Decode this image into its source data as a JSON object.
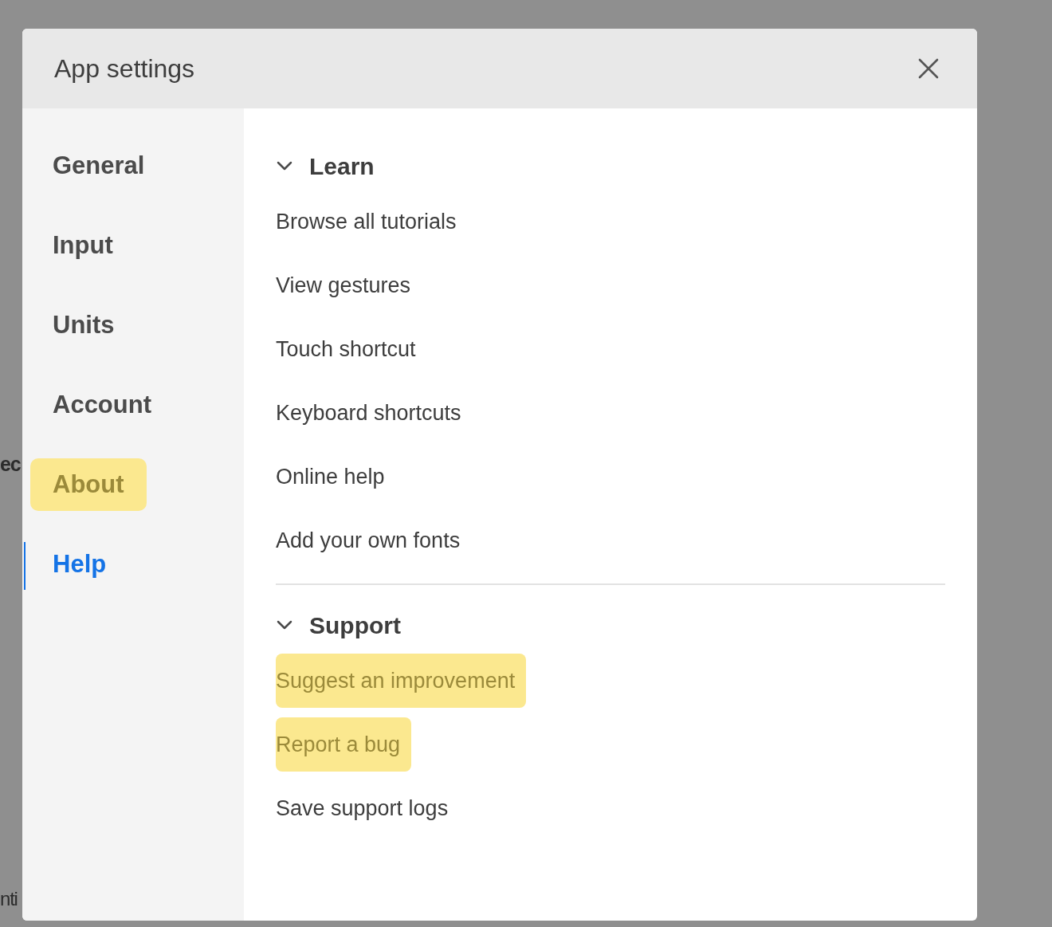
{
  "background": {
    "fragments": [
      "ec",
      "nti"
    ]
  },
  "dialog": {
    "title": "App settings",
    "sidebar": {
      "items": [
        {
          "label": "General",
          "selected": false,
          "highlighted": false
        },
        {
          "label": "Input",
          "selected": false,
          "highlighted": false
        },
        {
          "label": "Units",
          "selected": false,
          "highlighted": false
        },
        {
          "label": "Account",
          "selected": false,
          "highlighted": false
        },
        {
          "label": "About",
          "selected": false,
          "highlighted": true
        },
        {
          "label": "Help",
          "selected": true,
          "highlighted": false
        }
      ]
    },
    "sections": [
      {
        "title": "Learn",
        "expanded": true,
        "items": [
          {
            "label": "Browse all tutorials",
            "highlighted": false
          },
          {
            "label": "View gestures",
            "highlighted": false
          },
          {
            "label": "Touch shortcut",
            "highlighted": false
          },
          {
            "label": "Keyboard shortcuts",
            "highlighted": false
          },
          {
            "label": "Online help",
            "highlighted": false
          },
          {
            "label": "Add your own fonts",
            "highlighted": false
          }
        ]
      },
      {
        "title": "Support",
        "expanded": true,
        "items": [
          {
            "label": "Suggest an improvement",
            "highlighted": true
          },
          {
            "label": "Report a bug",
            "highlighted": true
          },
          {
            "label": "Save support logs",
            "highlighted": false
          }
        ]
      }
    ]
  }
}
